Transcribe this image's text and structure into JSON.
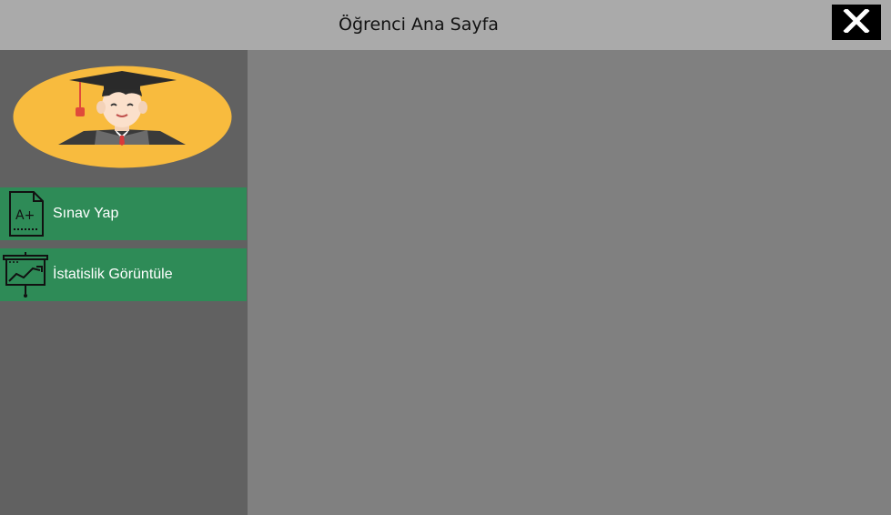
{
  "window": {
    "title": "Öğrenci Ana Sayfa",
    "close_icon": "close-icon"
  },
  "sidebar": {
    "avatar_icon": "student-graduate-icon",
    "items": [
      {
        "label": "Sınav Yap",
        "icon": "exam-grade-icon"
      },
      {
        "label": "İstatislik Görüntüle",
        "icon": "statistics-board-icon"
      }
    ]
  },
  "colors": {
    "titlebar": "#aaaaaa",
    "sidebar": "#616161",
    "main": "#808080",
    "menu_item": "#2e8b57",
    "avatar_bg": "#f8bb3e"
  }
}
